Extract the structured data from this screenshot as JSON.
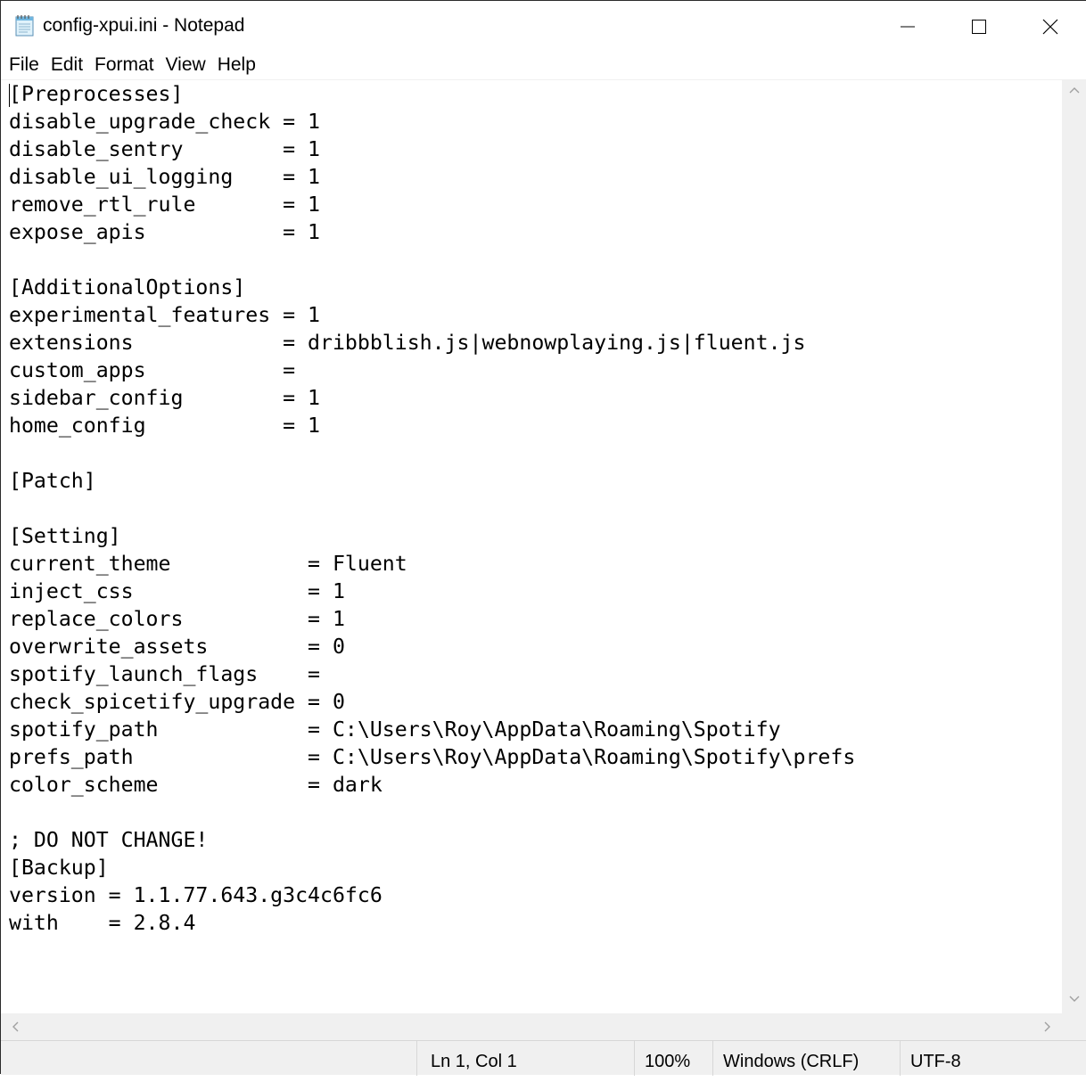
{
  "window": {
    "title": "config-xpui.ini - Notepad",
    "icon": "notepad-icon"
  },
  "controls": {
    "minimize_icon": "minimize-icon",
    "maximize_icon": "maximize-icon",
    "close_icon": "close-icon"
  },
  "menu": {
    "items": [
      {
        "label": "File"
      },
      {
        "label": "Edit"
      },
      {
        "label": "Format"
      },
      {
        "label": "View"
      },
      {
        "label": "Help"
      }
    ]
  },
  "editor": {
    "content": "[Preprocesses]\ndisable_upgrade_check = 1\ndisable_sentry        = 1\ndisable_ui_logging    = 1\nremove_rtl_rule       = 1\nexpose_apis           = 1\n\n[AdditionalOptions]\nexperimental_features = 1\nextensions            = dribbblish.js|webnowplaying.js|fluent.js\ncustom_apps           =\nsidebar_config        = 1\nhome_config           = 1\n\n[Patch]\n\n[Setting]\ncurrent_theme           = Fluent\ninject_css              = 1\nreplace_colors          = 1\noverwrite_assets        = 0\nspotify_launch_flags    =\ncheck_spicetify_upgrade = 0\nspotify_path            = C:\\Users\\Roy\\AppData\\Roaming\\Spotify\nprefs_path              = C:\\Users\\Roy\\AppData\\Roaming\\Spotify\\prefs\ncolor_scheme            = dark\n\n; DO NOT CHANGE!\n[Backup]\nversion = 1.1.77.643.g3c4c6fc6\nwith    = 2.8.4"
  },
  "statusbar": {
    "position": "Ln 1, Col 1",
    "zoom": "100%",
    "line_ending": "Windows (CRLF)",
    "encoding": "UTF-8"
  },
  "colors": {
    "chrome": "#f0f0f0",
    "text": "#000000",
    "background": "#ffffff"
  }
}
